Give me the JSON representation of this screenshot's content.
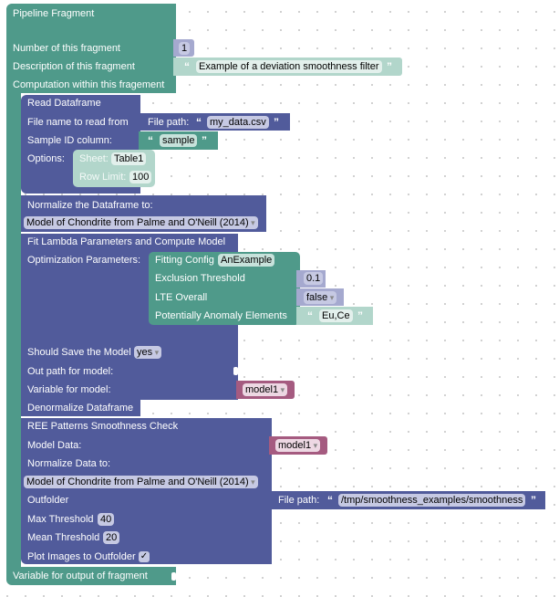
{
  "fragment": {
    "title": "Pipeline Fragment",
    "number_label": "Number of this fragment",
    "number_value": "1",
    "description_label": "Description of this fragment",
    "description_value": "Example of a deviation smoothness filter",
    "computation_label": "Computation within this fragement",
    "output_label": "Variable for output of fragment"
  },
  "read_dataframe": {
    "title": "Read Dataframe",
    "file_label": "File name to read from",
    "file_path_label": "File path:",
    "file_path_value": "my_data.csv",
    "sample_id_label": "Sample ID column:",
    "sample_id_value": "sample",
    "options_label": "Options:",
    "sheet_label": "Sheet:",
    "sheet_value": "Table1",
    "row_limit_label": "Row Limit:",
    "row_limit_value": "100"
  },
  "normalize": {
    "title": "Normalize the Dataframe to:",
    "selected": "Model of Chondrite from Palme and O'Neill (2014)"
  },
  "fit_lambda": {
    "title": "Fit Lambda Parameters and Compute Model",
    "opt_label": "Optimization Parameters:",
    "fitting_config_label": "Fitting Config",
    "fitting_config_value": "AnExample",
    "exclusion_label": "Exclusion Threshold",
    "exclusion_value": "0.1",
    "lte_label": "LTE Overall",
    "lte_value": "false",
    "anomaly_label": "Potentially Anomaly Elements",
    "anomaly_value": "Eu,Ce",
    "save_label": "Should Save the Model",
    "save_value": "yes",
    "outpath_label": "Out path for model:",
    "variable_label": "Variable for model:",
    "variable_value": "model1"
  },
  "denormalize": {
    "title": "Denormalize Dataframe"
  },
  "smoothness": {
    "title": "REE Patterns Smoothness Check",
    "model_data_label": "Model Data:",
    "model_data_value": "model1",
    "normalize_label": "Normalize Data to:",
    "normalize_value": "Model of Chondrite from Palme and O'Neill (2014)",
    "outfolder_label": "Outfolder",
    "outfolder_path_label": "File path:",
    "outfolder_path_value": "/tmp/smoothness_examples/smoothness",
    "max_label": "Max Threshold",
    "max_value": "40",
    "mean_label": "Mean Threshold",
    "mean_value": "20",
    "plot_label": "Plot Images to Outfolder",
    "plot_checked": "✓"
  },
  "quotes": {
    "open": "“",
    "close": "”"
  }
}
